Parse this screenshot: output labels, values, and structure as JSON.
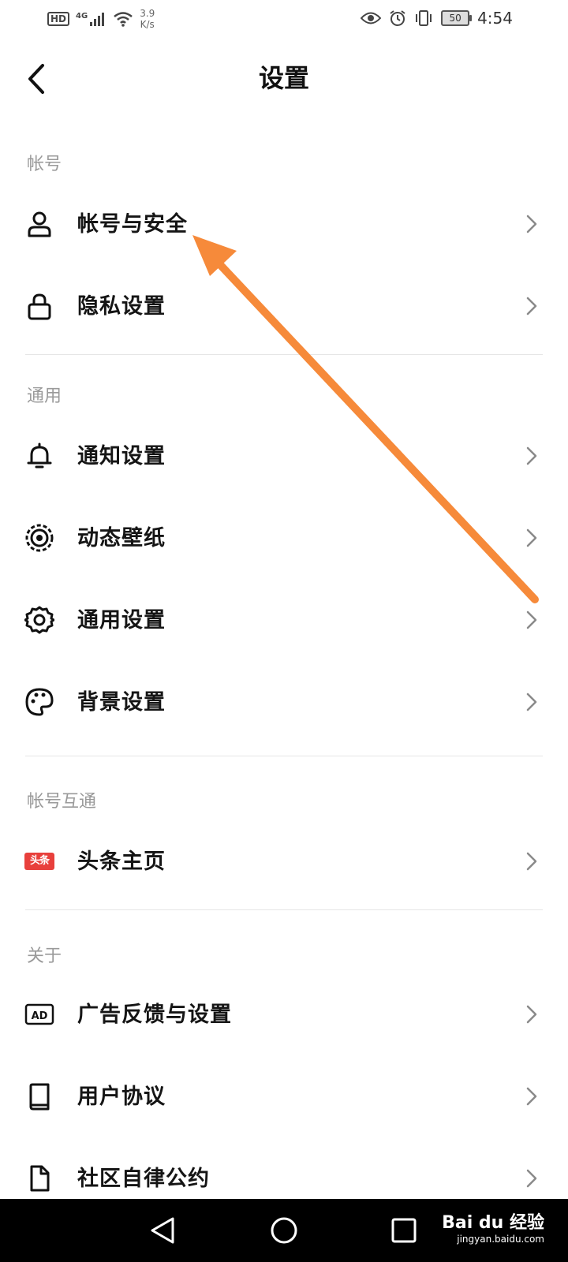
{
  "status_bar": {
    "hd": "HD",
    "network": "4G",
    "speed_value": "3.9",
    "speed_unit": "K/s",
    "battery": "50",
    "time": "4:54"
  },
  "header": {
    "title": "设置"
  },
  "sections": [
    {
      "title": "帐号",
      "items": [
        {
          "label": "帐号与安全",
          "icon": "user-icon"
        },
        {
          "label": "隐私设置",
          "icon": "lock-icon"
        }
      ]
    },
    {
      "title": "通用",
      "items": [
        {
          "label": "通知设置",
          "icon": "bell-icon"
        },
        {
          "label": "动态壁纸",
          "icon": "wallpaper-icon"
        },
        {
          "label": "通用设置",
          "icon": "gear-icon"
        },
        {
          "label": "背景设置",
          "icon": "palette-icon"
        }
      ]
    },
    {
      "title": "帐号互通",
      "items": [
        {
          "label": "头条主页",
          "icon": "toutiao-icon",
          "badge": "头条"
        }
      ]
    },
    {
      "title": "关于",
      "items": [
        {
          "label": "广告反馈与设置",
          "icon": "ad-icon",
          "badge": "AD"
        },
        {
          "label": "用户协议",
          "icon": "book-icon"
        },
        {
          "label": "社区自律公约",
          "icon": "document-icon"
        }
      ]
    }
  ],
  "watermark": {
    "brand": "Bai du 经验",
    "url": "jingyan.baidu.com"
  },
  "colors": {
    "annotation_arrow": "#f68a3a",
    "toutiao_red": "#e8403c"
  }
}
